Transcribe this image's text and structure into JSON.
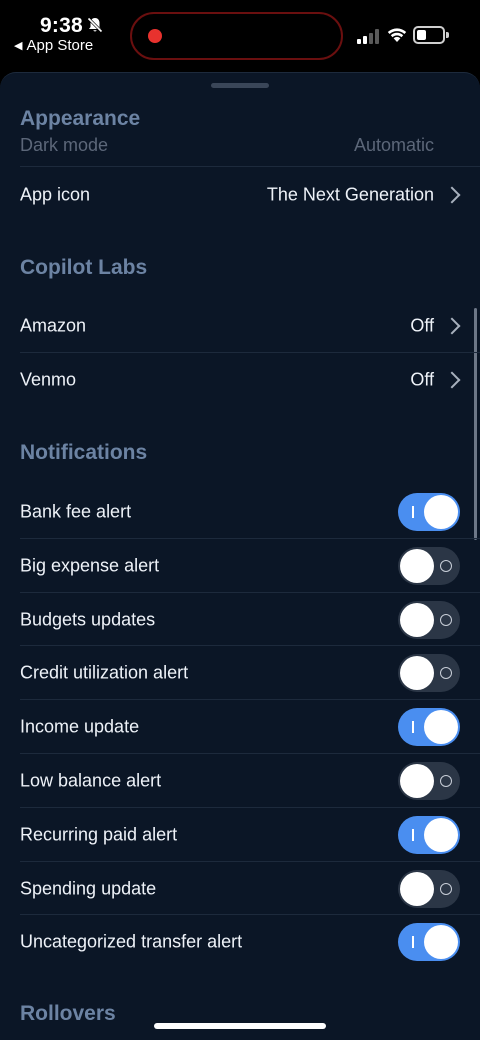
{
  "status_bar": {
    "time": "9:38",
    "back_app": "App Store",
    "icons": [
      "bell-slash-icon",
      "signal-icon",
      "wifi-icon",
      "battery-icon"
    ],
    "recording_color": "#e8322e"
  },
  "sections": {
    "appearance": {
      "title": "Appearance",
      "clipped_row": {
        "label": "Dark mode",
        "value": "Automatic"
      },
      "app_icon": {
        "label": "App icon",
        "value": "The Next Generation"
      }
    },
    "copilot_labs": {
      "title": "Copilot Labs",
      "amazon": {
        "label": "Amazon",
        "value": "Off"
      },
      "venmo": {
        "label": "Venmo",
        "value": "Off"
      }
    },
    "notifications": {
      "title": "Notifications",
      "items": [
        {
          "label": "Bank fee alert",
          "on": true
        },
        {
          "label": "Big expense alert",
          "on": false
        },
        {
          "label": "Budgets updates",
          "on": false
        },
        {
          "label": "Credit utilization alert",
          "on": false
        },
        {
          "label": "Income update",
          "on": true
        },
        {
          "label": "Low balance alert",
          "on": false
        },
        {
          "label": "Recurring paid alert",
          "on": true
        },
        {
          "label": "Spending update",
          "on": false
        },
        {
          "label": "Uncategorized transfer alert",
          "on": true
        }
      ]
    },
    "rollovers": {
      "title": "Rollovers"
    }
  },
  "colors": {
    "toggle_on": "#4a8ef0",
    "toggle_off": "#2b3646",
    "section_title": "#6c83a3",
    "background": "#0b1626"
  }
}
